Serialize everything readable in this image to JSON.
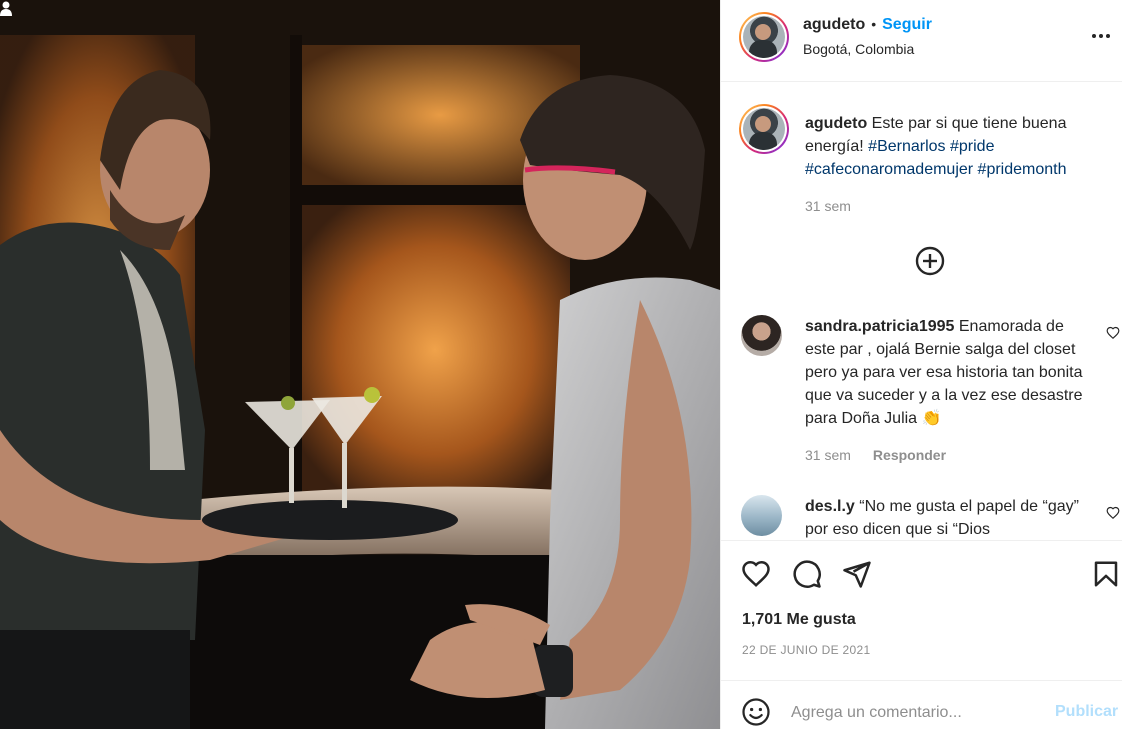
{
  "post": {
    "photo_alt": "two men in a bar, one holding a tray with martinis",
    "user_tag_icon": "user-tag-icon"
  },
  "header": {
    "username": "agudeto",
    "separator": "•",
    "follow_label": "Seguir",
    "location": "Bogotá, Colombia",
    "more_icon": "more-options-icon"
  },
  "caption": {
    "username": "agudeto",
    "text": "Este par si que tiene buena energía!",
    "hashtags": [
      "#Bernarlos",
      "#pride",
      "#cafeconaromademujer",
      "#pridemonth"
    ],
    "time": "31 sem"
  },
  "load_more_icon": "plus-circle-icon",
  "comments": [
    {
      "username": "sandra.patricia1995",
      "text": "Enamorada de este par , ojalá Bernie salga del closet pero ya para ver esa historia tan bonita que va suceder y a la vez ese desastre para Doña Julia 👏",
      "time": "31 sem",
      "reply_label": "Responder"
    },
    {
      "username": "des.l.y",
      "text": "“No me gusta el papel de “gay” por eso dicen que si “Dios",
      "time": "",
      "reply_label": ""
    }
  ],
  "actions": {
    "like_icon": "heart-icon",
    "comment_icon": "comment-icon",
    "share_icon": "share-icon",
    "save_icon": "bookmark-icon",
    "likes": "1,701 Me gusta",
    "date": "22 DE JUNIO DE 2021"
  },
  "add_comment": {
    "placeholder": "Agrega un comentario...",
    "post_label": "Publicar",
    "emoji_icon": "emoji-icon"
  },
  "colors": {
    "accent": "#0095f6",
    "hashtag": "#00376b",
    "muted": "#8e8e8e",
    "post_disabled": "#b2dffc"
  }
}
